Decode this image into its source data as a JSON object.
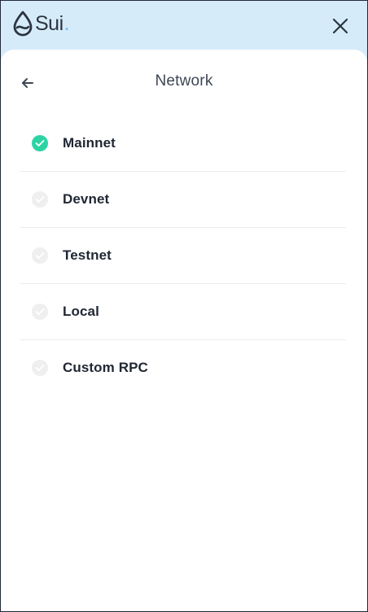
{
  "brand": {
    "name": "Sui",
    "dot": ".",
    "accent_color": "#6fbcf0",
    "logo_icon": "sui-drop-icon"
  },
  "topbar": {
    "close_icon": "close-icon",
    "background": "#d6ebf9"
  },
  "panel": {
    "title": "Network",
    "back_icon": "arrow-left-icon"
  },
  "networks": [
    {
      "label": "Mainnet",
      "selected": true
    },
    {
      "label": "Devnet",
      "selected": false
    },
    {
      "label": "Testnet",
      "selected": false
    },
    {
      "label": "Local",
      "selected": false
    },
    {
      "label": "Custom RPC",
      "selected": false
    }
  ],
  "colors": {
    "check_selected": "#2dd4a3",
    "check_unselected": "#efefef"
  }
}
